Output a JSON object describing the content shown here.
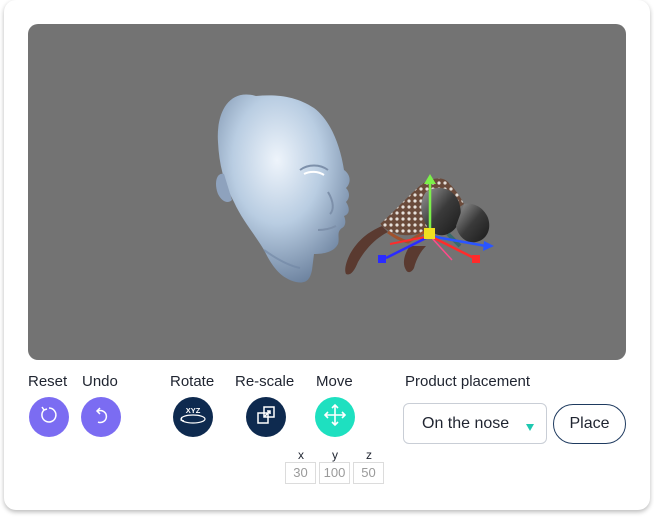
{
  "toolbar": {
    "reset_label": "Reset",
    "undo_label": "Undo",
    "rotate_label": "Rotate",
    "rescale_label": "Re-scale",
    "move_label": "Move",
    "rotate_icon_text": "XYZ"
  },
  "coordinates": {
    "x_label": "x",
    "y_label": "y",
    "z_label": "z",
    "x_value": "30",
    "y_value": "100",
    "z_value": "50"
  },
  "placement": {
    "label": "Product placement",
    "selected": "On the nose",
    "place_label": "Place"
  },
  "colors": {
    "viewport_bg": "#737373",
    "undo_accent": "#7b6cf2",
    "navy": "#0e2a4f",
    "move_accent": "#1ee0c0",
    "caret": "#1ec8b0"
  },
  "icons": {
    "reset": "rotate-ccw-icon",
    "undo": "undo-icon",
    "rotate": "rotate-xyz-icon",
    "rescale": "rescale-icon",
    "move": "move-arrows-icon",
    "caret": "caret-down-icon"
  }
}
